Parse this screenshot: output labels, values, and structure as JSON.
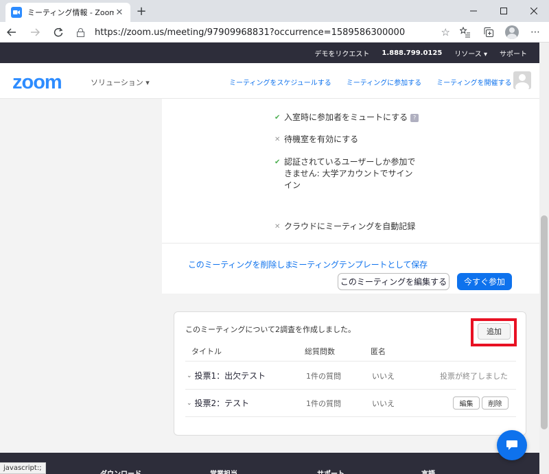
{
  "browser": {
    "tab_title": "ミーティング情報 - Zoom",
    "tab_close": "✕",
    "new_tab": "+",
    "url": "https://zoom.us/meeting/97909968831?occurrence=1589586300000",
    "status_text": "javascript:;"
  },
  "topbar": {
    "demo": "デモをリクエスト",
    "phone": "1.888.799.0125",
    "resources": "リソース ▾",
    "support": "サポート"
  },
  "nav": {
    "logo": "zoom",
    "solutions": "ソリューション ▾",
    "schedule": "ミーティングをスケジュールする",
    "join": "ミーティングに参加する",
    "host": "ミーティングを開催する ▾"
  },
  "options": [
    {
      "mark": "✔",
      "text": "入室時に参加者をミュートにする",
      "badge": "?"
    },
    {
      "mark": "✕",
      "text": "待機室を有効にする"
    },
    {
      "mark": "✔",
      "text": "認証されているユーザーしか参加で",
      "text2": "きません: 大学アカウントでサイン",
      "text3": "イン"
    },
    {
      "mark": "✕",
      "text": "クラウドにミーティングを自動記録"
    }
  ],
  "actions": {
    "delete_link": "このミーティングを削除しま",
    "template_link": "ミーティングテンプレートとして保存",
    "edit_button": "このミーティングを編集する",
    "join_button": "今すぐ参加"
  },
  "polls": {
    "intro": "このミーティングについて2調査を作成しました。",
    "add_button": "追加",
    "headers": {
      "title": "タイトル",
      "questions": "総質問数",
      "anonymous": "匿名"
    },
    "rows": [
      {
        "title": "投票1：出欠テスト",
        "questions": "1件の質問",
        "anonymous": "いいえ",
        "status": "投票が終了しました"
      },
      {
        "title": "投票2：テスト",
        "questions": "1件の質問",
        "anonymous": "いいえ",
        "edit": "編集",
        "delete": "削除"
      }
    ]
  },
  "footer": {
    "download": "ダウンロード",
    "sales": "営業担当",
    "support": "サポート",
    "language": "言語"
  },
  "colors": {
    "accent": "#0e72ed",
    "logo": "#2d8cff",
    "highlight": "#e81123",
    "dark_bar": "#2d2d3a"
  }
}
